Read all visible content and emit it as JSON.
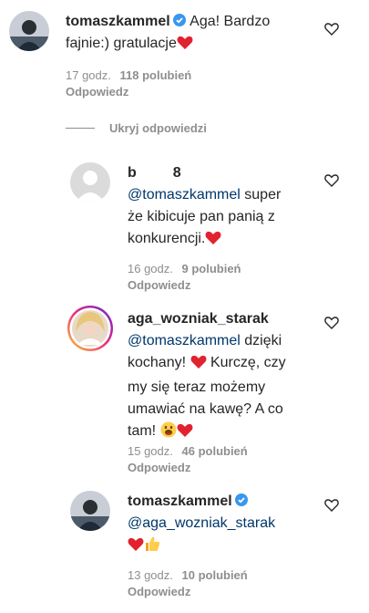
{
  "comments": [
    {
      "username": "tomaszkammel",
      "verified": true,
      "text_a": "Aga! Bardzo",
      "text_b": "fajnie:) gratulacje",
      "time": "17 godz.",
      "likes": "118 polubień",
      "reply": "Odpowiedz"
    },
    {
      "username": "b         8",
      "mention": "@tomaszkammel",
      "text_a": " super",
      "text_b": "że kibicuje pan panią z",
      "text_c": "konkurencji.",
      "time": "16 godz.",
      "likes": "9 polubień",
      "reply": "Odpowiedz"
    },
    {
      "username": "aga_wozniak_starak",
      "mention": "@tomaszkammel",
      "text_a": " dzięki",
      "text_b": "kochany!",
      "text_b2": " Kurczę, czy",
      "text_c": "my się teraz możemy",
      "text_d": "umawiać na kawę? A co",
      "text_e": "tam!",
      "time": "15 godz.",
      "likes": "46 polubień",
      "reply": "Odpowiedz"
    },
    {
      "username": "tomaszkammel",
      "verified": true,
      "mention": "@aga_wozniak_starak",
      "time": "13 godz.",
      "likes": "10 polubień",
      "reply": "Odpowiedz"
    }
  ],
  "hide_replies": "Ukryj odpowiedzi",
  "colors": {
    "text": "#262626",
    "meta": "#8e8e8e",
    "mention": "#00376b",
    "verified": "#3897f0",
    "heart": "#e0232e"
  }
}
